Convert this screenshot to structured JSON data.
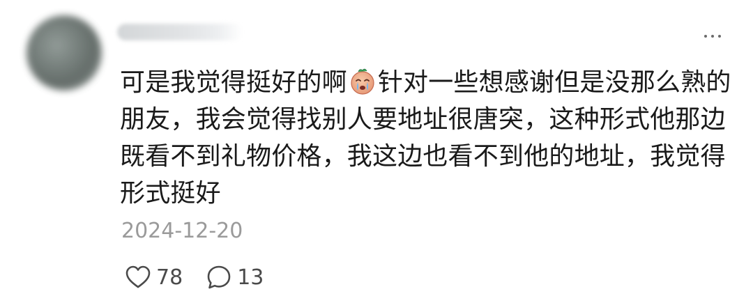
{
  "comment": {
    "text_before_emoji": "可是我觉得挺好的啊",
    "emoji": "crying-face-emoji",
    "text_after_emoji": "针对一些想感谢但是没那么熟的朋友，我会觉得找别人要地址很唐突，这种形式他那边既看不到礼物价格，我这边也看不到他的地址，我觉得形式挺好",
    "date": "2024-12-20",
    "likes": "78",
    "replies": "13"
  },
  "icons": {
    "more": "more-dots-icon",
    "like": "heart-outline-icon",
    "reply": "speech-bubble-outline-icon"
  },
  "colors": {
    "text": "#1a1a1a",
    "meta": "#9a9a9a",
    "icon": "#4a4a4a",
    "background": "#ffffff"
  }
}
